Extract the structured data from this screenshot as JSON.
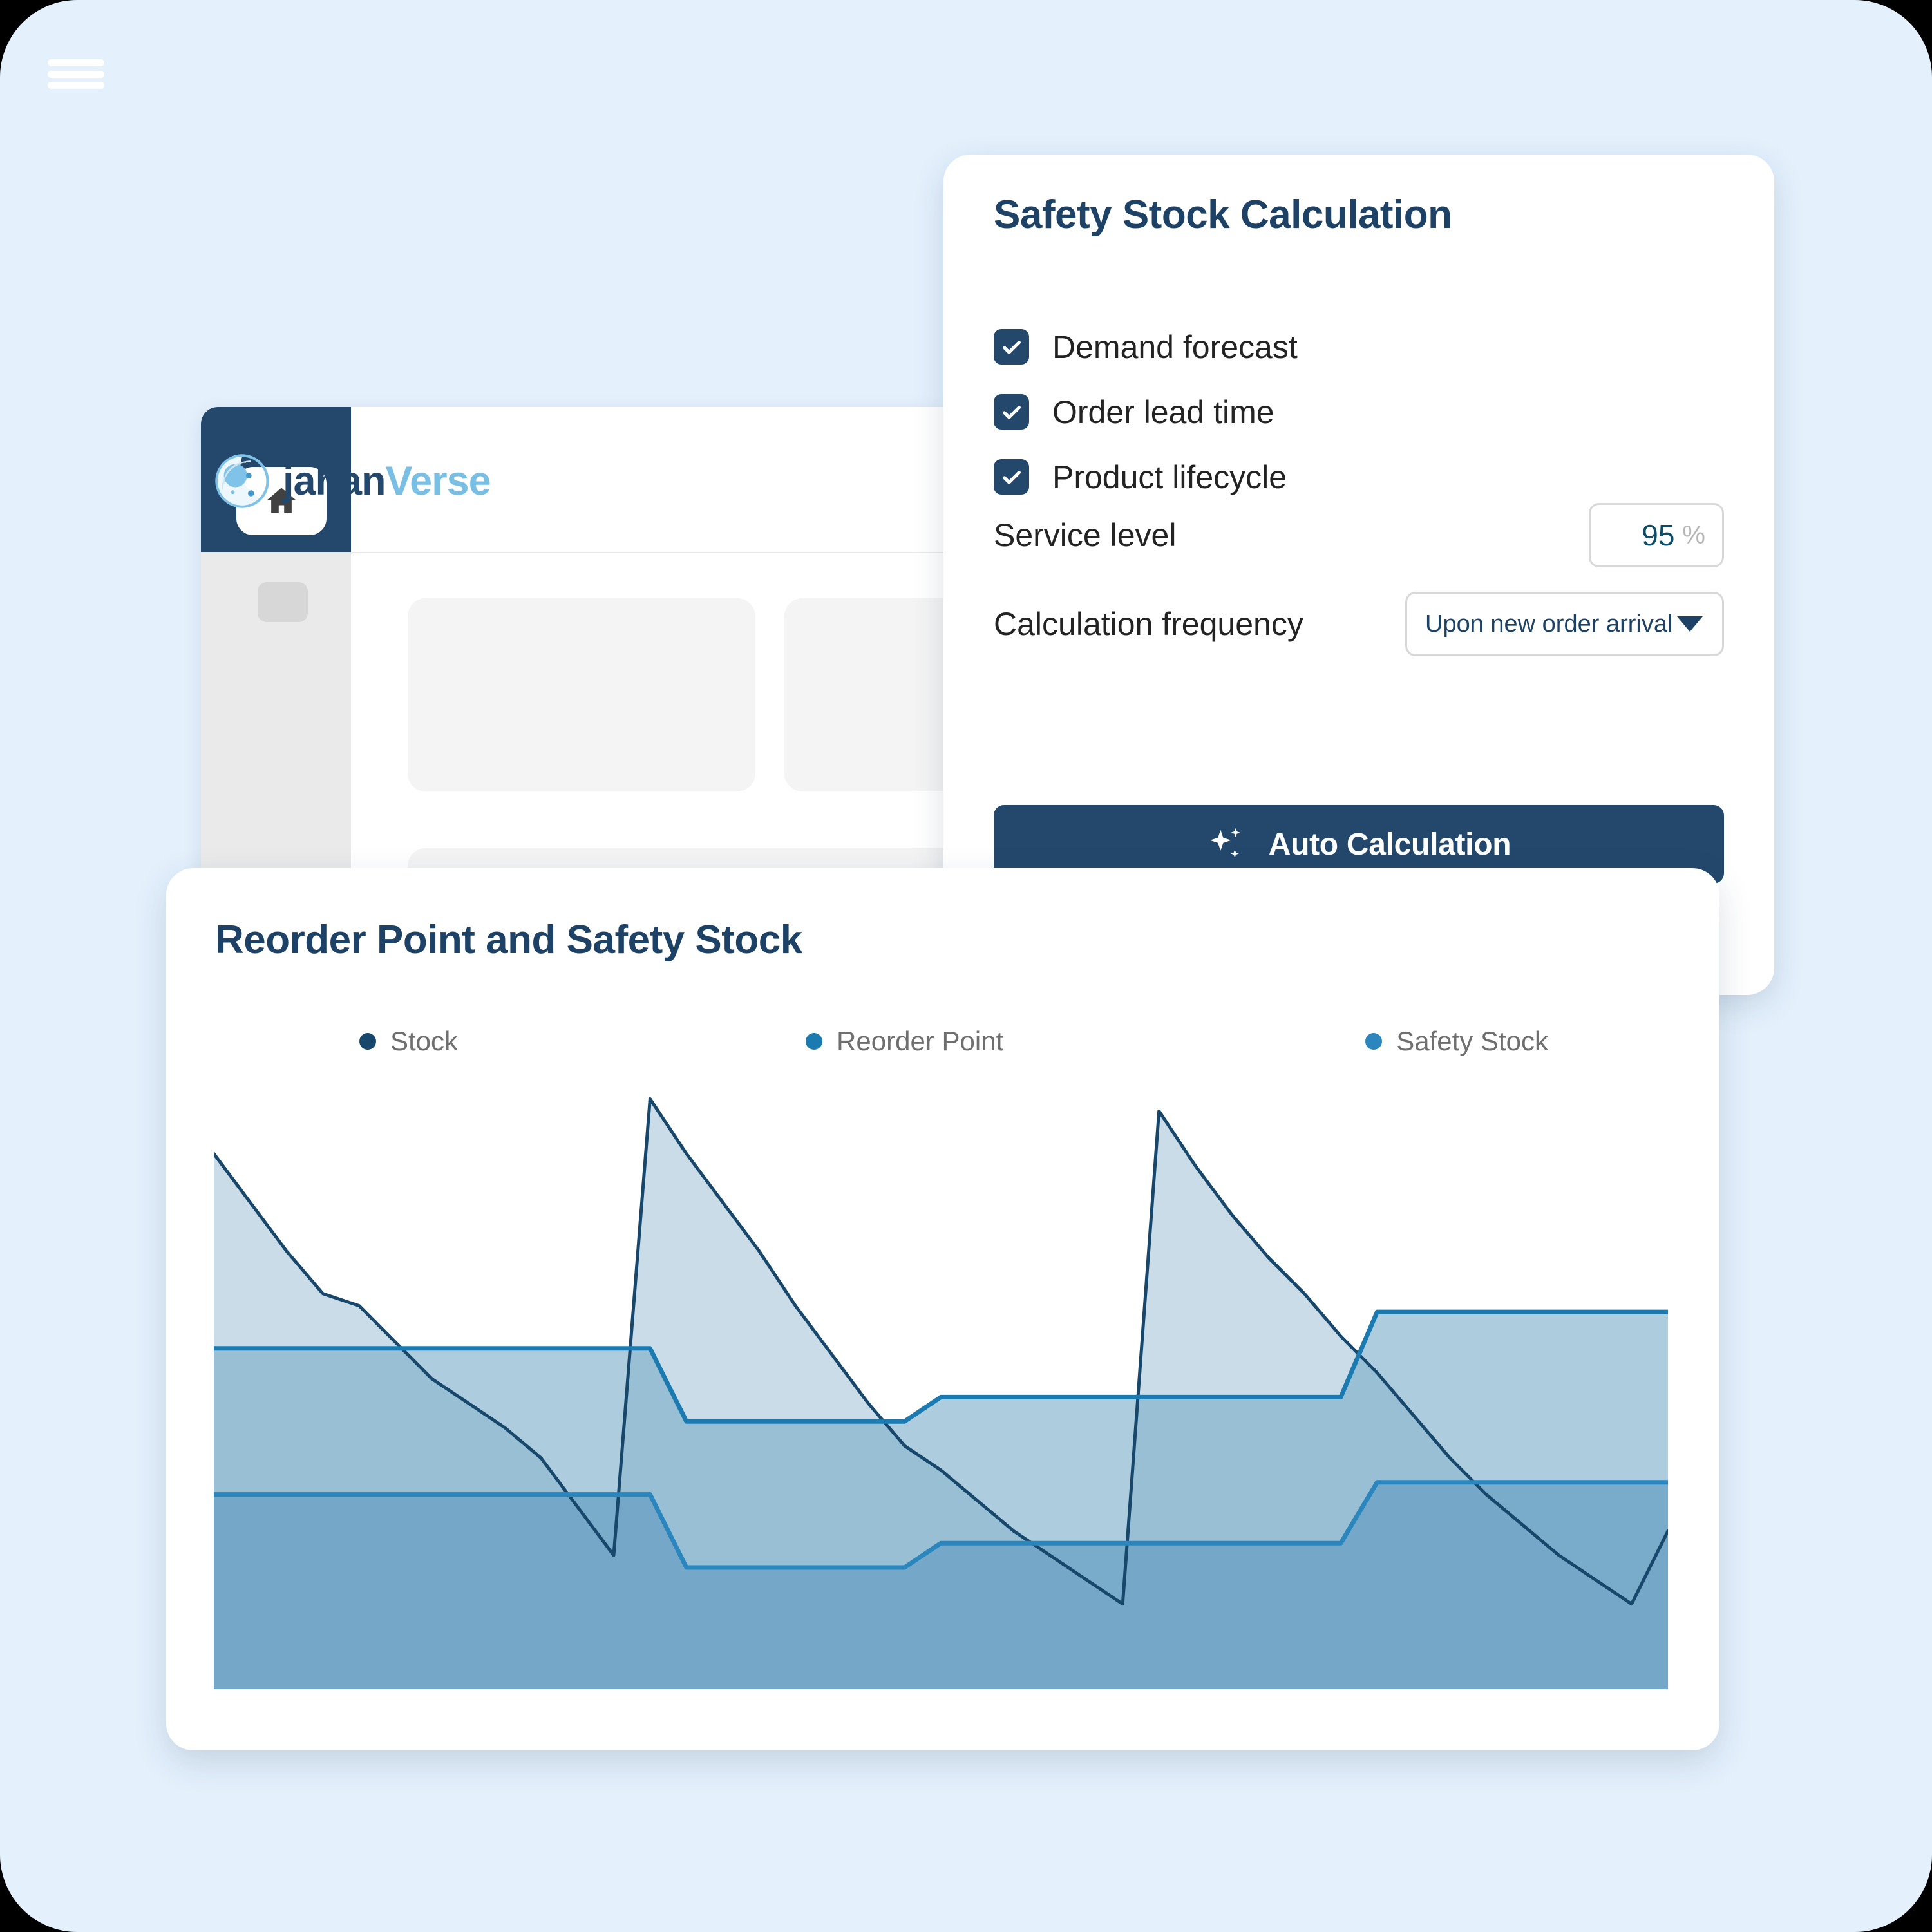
{
  "theme": {
    "page_bg": "#e4f0fc",
    "navy": "#23486b",
    "accent_light": "#79bfe4",
    "stock_color": "#17476b",
    "reorder_color": "#1b7bb0",
    "safety_color": "#2a86bd"
  },
  "app": {
    "logo_primary": "jahan",
    "logo_secondary": "Verse",
    "menu_icon": "hamburger-icon",
    "home_icon": "home-icon"
  },
  "safety_panel": {
    "title": "Safety Stock Calculation",
    "checkboxes": [
      {
        "label": "Demand forecast",
        "checked": true
      },
      {
        "label": "Order lead time",
        "checked": true
      },
      {
        "label": "Product lifecycle",
        "checked": true
      }
    ],
    "service_level": {
      "label": "Service level",
      "value": "95",
      "unit": "%"
    },
    "frequency": {
      "label": "Calculation frequency",
      "value": "Upon new order arrival",
      "caret_icon": "chevron-down-icon"
    },
    "auto_button": {
      "label": "Auto Calculation",
      "icon": "sparkles-icon"
    }
  },
  "chart_card": {
    "title": "Reorder Point and Safety Stock"
  },
  "chart_data": {
    "type": "area",
    "title": "Reorder Point and Safety Stock",
    "xlabel": "",
    "ylabel": "",
    "grid": false,
    "legend_position": "top",
    "xlim": [
      0,
      40
    ],
    "ylim": [
      0,
      100
    ],
    "legend": [
      "Stock",
      "Reorder Point",
      "Safety Stock"
    ],
    "colors": {
      "Stock": "#17476b",
      "Reorder Point": "#1b7bb0",
      "Safety Stock": "#2a86bd"
    },
    "x": [
      0,
      1,
      2,
      3,
      4,
      5,
      6,
      7,
      8,
      9,
      10,
      11,
      12,
      13,
      14,
      15,
      16,
      17,
      18,
      19,
      20,
      21,
      22,
      23,
      24,
      25,
      26,
      27,
      28,
      29,
      30,
      31,
      32,
      33,
      34,
      35,
      36,
      37,
      38,
      39,
      40
    ],
    "series": [
      {
        "name": "Stock",
        "values": [
          88,
          80,
          72,
          65,
          63,
          57,
          51,
          47,
          43,
          38,
          30,
          22,
          97,
          88,
          80,
          72,
          63,
          55,
          47,
          40,
          36,
          31,
          26,
          22,
          18,
          14,
          95,
          86,
          78,
          71,
          65,
          58,
          52,
          45,
          38,
          32,
          27,
          22,
          18,
          14,
          26
        ]
      },
      {
        "name": "Reorder Point",
        "values": [
          56,
          56,
          56,
          56,
          56,
          56,
          56,
          56,
          56,
          56,
          56,
          56,
          56,
          44,
          44,
          44,
          44,
          44,
          44,
          44,
          48,
          48,
          48,
          48,
          48,
          48,
          48,
          48,
          48,
          48,
          48,
          48,
          62,
          62,
          62,
          62,
          62,
          62,
          62,
          62,
          62
        ]
      },
      {
        "name": "Safety Stock",
        "values": [
          32,
          32,
          32,
          32,
          32,
          32,
          32,
          32,
          32,
          32,
          32,
          32,
          32,
          20,
          20,
          20,
          20,
          20,
          20,
          20,
          24,
          24,
          24,
          24,
          24,
          24,
          24,
          24,
          24,
          24,
          24,
          24,
          34,
          34,
          34,
          34,
          34,
          34,
          34,
          34,
          34
        ]
      }
    ]
  }
}
